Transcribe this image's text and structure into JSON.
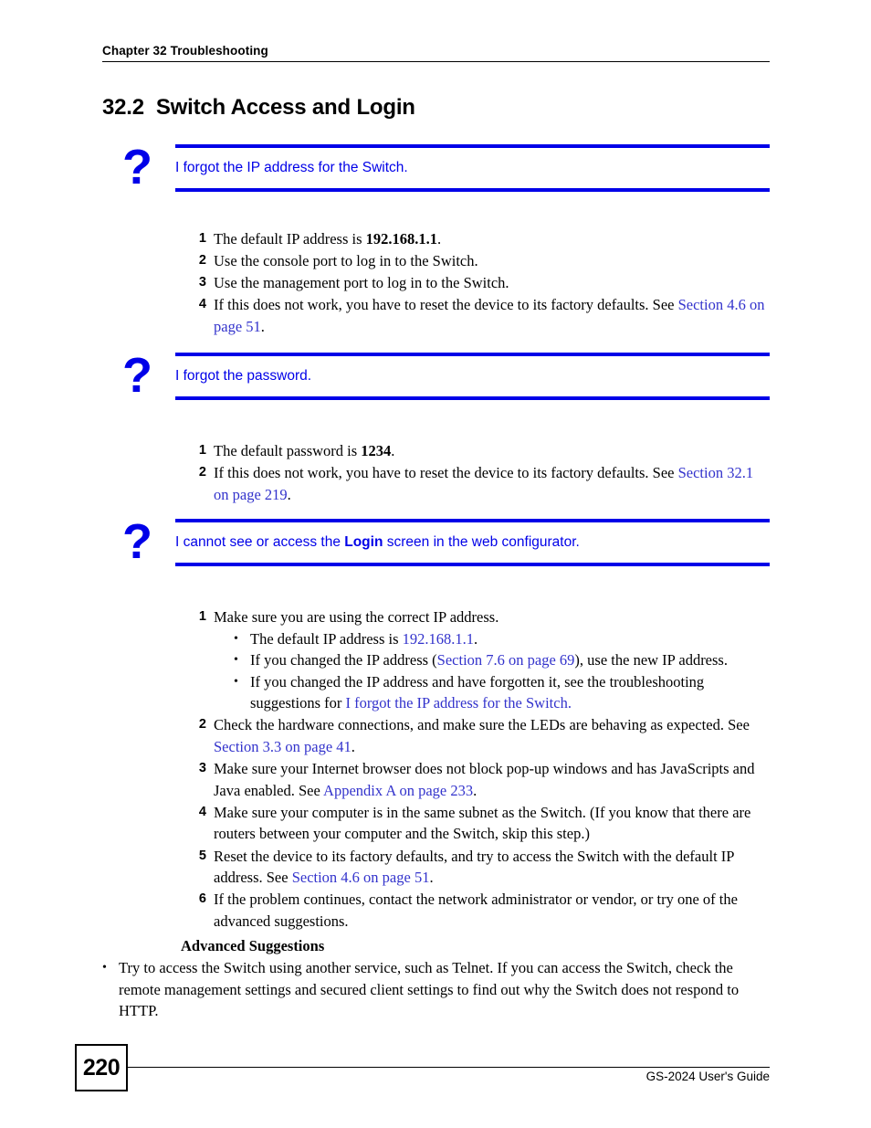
{
  "header": {
    "chapter": "Chapter 32 Troubleshooting"
  },
  "section": {
    "number": "32.2",
    "title": "Switch Access and Login",
    "heading_full": "32.2  Switch Access and Login"
  },
  "icons": {
    "question_mark": "?",
    "bullet": "•"
  },
  "faq": [
    {
      "question_prefix": "I forgot the IP address for the Switch.",
      "question_bold": "",
      "question_suffix": "",
      "steps": [
        {
          "num": "1",
          "parts": [
            {
              "text": "The default IP address is ",
              "style": "normal"
            },
            {
              "text": "192.168.1.1",
              "style": "bold"
            },
            {
              "text": ".",
              "style": "normal"
            }
          ]
        },
        {
          "num": "2",
          "parts": [
            {
              "text": "Use the console port to log in to the Switch.",
              "style": "normal"
            }
          ]
        },
        {
          "num": "3",
          "parts": [
            {
              "text": "Use the management port to log in to the Switch.",
              "style": "normal"
            }
          ]
        },
        {
          "num": "4",
          "parts": [
            {
              "text": "If this does not work, you have to reset the device to its factory defaults. See ",
              "style": "normal"
            },
            {
              "text": "Section 4.6 on page 51",
              "style": "link"
            },
            {
              "text": ".",
              "style": "normal"
            }
          ]
        }
      ]
    },
    {
      "question_prefix": "I forgot the password.",
      "question_bold": "",
      "question_suffix": "",
      "steps": [
        {
          "num": "1",
          "parts": [
            {
              "text": "The default password is ",
              "style": "normal"
            },
            {
              "text": "1234",
              "style": "bold"
            },
            {
              "text": ".",
              "style": "normal"
            }
          ]
        },
        {
          "num": "2",
          "parts": [
            {
              "text": "If this does not work, you have to reset the device to its factory defaults. See ",
              "style": "normal"
            },
            {
              "text": "Section 32.1 on page 219",
              "style": "link"
            },
            {
              "text": ".",
              "style": "normal"
            }
          ]
        }
      ]
    },
    {
      "question_prefix": "I cannot see or access the ",
      "question_bold": "Login",
      "question_suffix": " screen in the web configurator.",
      "steps": [
        {
          "num": "1",
          "parts": [
            {
              "text": "Make sure you are using the correct IP address.",
              "style": "normal"
            }
          ],
          "subbullets": [
            [
              {
                "text": "The default IP address is ",
                "style": "normal"
              },
              {
                "text": "192.168.1.1",
                "style": "link"
              },
              {
                "text": ".",
                "style": "normal"
              }
            ],
            [
              {
                "text": "If you changed the IP address (",
                "style": "normal"
              },
              {
                "text": "Section 7.6 on page 69",
                "style": "link"
              },
              {
                "text": "), use the new IP address.",
                "style": "normal"
              }
            ],
            [
              {
                "text": "If you changed the IP address and have forgotten it, see the troubleshooting suggestions for ",
                "style": "normal"
              },
              {
                "text": "I forgot the IP address for the Switch.",
                "style": "link"
              }
            ]
          ]
        },
        {
          "num": "2",
          "parts": [
            {
              "text": "Check the hardware connections, and make sure the LEDs are behaving as expected. See ",
              "style": "normal"
            },
            {
              "text": "Section 3.3 on page 41",
              "style": "link"
            },
            {
              "text": ".",
              "style": "normal"
            }
          ]
        },
        {
          "num": "3",
          "parts": [
            {
              "text": "Make sure your Internet browser does not block pop-up windows and has JavaScripts and Java enabled. See ",
              "style": "normal"
            },
            {
              "text": "Appendix A on page 233",
              "style": "link"
            },
            {
              "text": ".",
              "style": "normal"
            }
          ]
        },
        {
          "num": "4",
          "parts": [
            {
              "text": "Make sure your computer is in the same subnet as the Switch. (If you know that there are routers between your computer and the Switch, skip this step.)",
              "style": "normal"
            }
          ]
        },
        {
          "num": "5",
          "parts": [
            {
              "text": "Reset the device to its factory defaults, and try to access the Switch with the default IP address. See ",
              "style": "normal"
            },
            {
              "text": "Section 4.6 on page 51",
              "style": "link"
            },
            {
              "text": ".",
              "style": "normal"
            }
          ]
        },
        {
          "num": "6",
          "parts": [
            {
              "text": "If the problem continues, contact the network administrator or vendor, or try one of the advanced suggestions.",
              "style": "normal"
            }
          ]
        }
      ],
      "advanced": {
        "heading": "Advanced Suggestions",
        "items": [
          [
            {
              "text": "Try to access the Switch using another service, such as Telnet. If you can access the Switch, check the remote management settings and secured client settings to find out why the Switch does not respond to HTTP.",
              "style": "normal"
            }
          ]
        ]
      }
    }
  ],
  "footer": {
    "page_number": "220",
    "guide_title": "GS-2024 User's Guide"
  },
  "colors": {
    "link": "#3333cc",
    "question_blue": "#0000e8",
    "text": "#000000"
  }
}
